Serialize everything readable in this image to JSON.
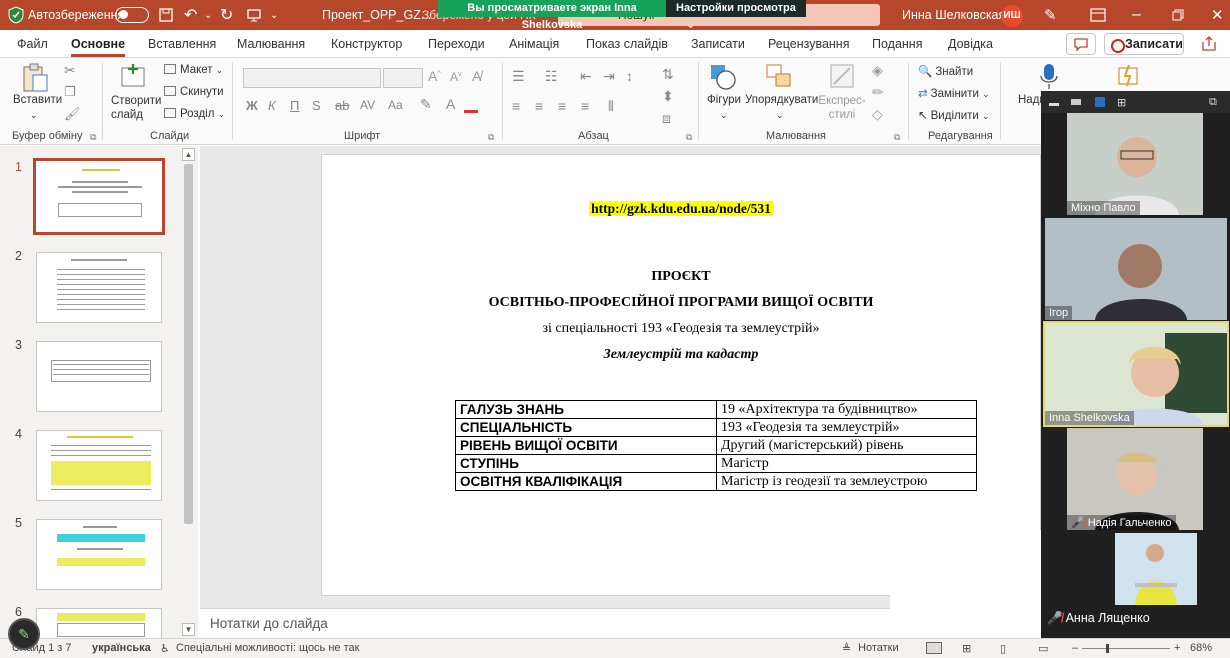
{
  "titlebar": {
    "autosave_label": "Автозбереження",
    "doc_title": "Проект_OPP_GZ...",
    "saved_state": "Збережено у цей ПК",
    "search_placeholder": "Пошук",
    "user_name": "Инна Шелковская",
    "user_initials": "ИШ",
    "share_banner_text": "Вы просматриваете экран Inna Shelkovska",
    "share_settings_label": "Настройки просмотра"
  },
  "menu": {
    "tabs": [
      "Файл",
      "Основне",
      "Вставлення",
      "Малювання",
      "Конструктор",
      "Переходи",
      "Анімація",
      "Показ слайдів",
      "Записати",
      "Рецензування",
      "Подання",
      "Довідка"
    ],
    "active": "Основне",
    "record_label": "Записати"
  },
  "ribbon": {
    "paste": "Вставити",
    "clipboard_group": "Буфер обміну",
    "new_slide": "Створити слайд",
    "layout": "Макет",
    "reset": "Скинути",
    "section": "Розділ",
    "slides_group": "Слайди",
    "font_group": "Шрифт",
    "paragraph_group": "Абзац",
    "shapes": "Фігури",
    "arrange": "Упорядкувати",
    "quick_styles": "Експрес-стилі",
    "drawing_group": "Малювання",
    "find": "Знайти",
    "replace": "Замінити",
    "select": "Виділити",
    "editing_group": "Редагування",
    "dictate": "Надиктувати",
    "designer": "Го"
  },
  "thumbnails": {
    "numbers": [
      "1",
      "2",
      "3",
      "4",
      "5",
      "6"
    ],
    "selected": "1"
  },
  "slide": {
    "url": "http://gzk.kdu.edu.ua/node/531",
    "heading1": "ПРОЄКТ",
    "heading2": "ОСВІТНЬО-ПРОФЕСІЙНОЇ ПРОГРАМИ ВИЩОЇ ОСВІТИ",
    "heading3": "зі спеціальності 193 «Геодезія та землеустрій»",
    "heading4": "Землеустрій та кадастр",
    "table": [
      [
        "ГАЛУЗЬ ЗНАНЬ",
        "19 «Архітектура та будівництво»"
      ],
      [
        "СПЕЦІАЛЬНІСТЬ",
        "193 «Геодезія та землеустрій»"
      ],
      [
        "РІВЕНЬ ВИЩОЇ ОСВІТИ",
        "Другий (магістерський) рівень"
      ],
      [
        "СТУПІНЬ",
        "Магістр"
      ],
      [
        "ОСВІТНЯ КВАЛІФІКАЦІЯ",
        "Магістр із геодезії та землеустрою"
      ]
    ]
  },
  "notes": {
    "placeholder": "Нотатки до слайда"
  },
  "status": {
    "slide_info": "Слайд 1 з 7",
    "language": "українська",
    "accessibility": "Спеціальні можливості: щось не так",
    "notes_btn": "Нотатки",
    "zoom": "68%"
  },
  "participants": [
    {
      "name": "Міхно Павло",
      "muted": false,
      "speaking": false
    },
    {
      "name": "Ігор",
      "muted": false,
      "speaking": false
    },
    {
      "name": "Inna Shelkovska",
      "muted": false,
      "speaking": true
    },
    {
      "name": "Надія Гальченко",
      "muted": true,
      "speaking": false
    },
    {
      "name": "Анна Лященко",
      "muted": true,
      "speaking": false
    }
  ],
  "colors": {
    "accent": "#b7472a",
    "share_green": "#19a35a",
    "highlight": "#ffff00"
  }
}
